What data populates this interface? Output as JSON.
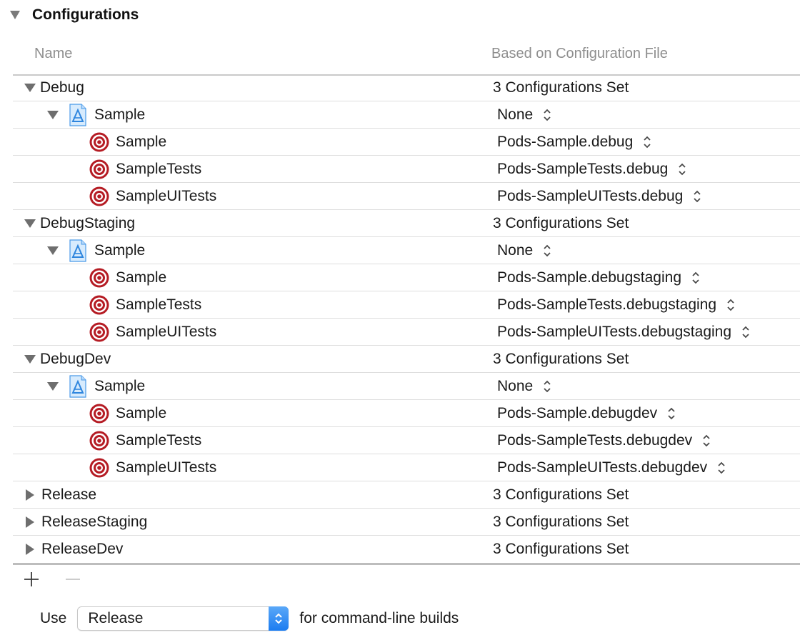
{
  "section": {
    "title": "Configurations"
  },
  "columns": {
    "name": "Name",
    "based_on": "Based on Configuration File"
  },
  "configurations": [
    {
      "name": "Debug",
      "expanded": true,
      "summary": "3 Configurations Set",
      "project": {
        "name": "Sample",
        "value": "None"
      },
      "targets": [
        {
          "name": "Sample",
          "value": "Pods-Sample.debug"
        },
        {
          "name": "SampleTests",
          "value": "Pods-SampleTests.debug"
        },
        {
          "name": "SampleUITests",
          "value": "Pods-SampleUITests.debug"
        }
      ]
    },
    {
      "name": "DebugStaging",
      "expanded": true,
      "summary": "3 Configurations Set",
      "project": {
        "name": "Sample",
        "value": "None"
      },
      "targets": [
        {
          "name": "Sample",
          "value": "Pods-Sample.debugstaging"
        },
        {
          "name": "SampleTests",
          "value": "Pods-SampleTests.debugstaging"
        },
        {
          "name": "SampleUITests",
          "value": "Pods-SampleUITests.debugstaging"
        }
      ]
    },
    {
      "name": "DebugDev",
      "expanded": true,
      "summary": "3 Configurations Set",
      "project": {
        "name": "Sample",
        "value": "None"
      },
      "targets": [
        {
          "name": "Sample",
          "value": "Pods-Sample.debugdev"
        },
        {
          "name": "SampleTests",
          "value": "Pods-SampleTests.debugdev"
        },
        {
          "name": "SampleUITests",
          "value": "Pods-SampleUITests.debugdev"
        }
      ]
    },
    {
      "name": "Release",
      "expanded": false,
      "summary": "3 Configurations Set"
    },
    {
      "name": "ReleaseStaging",
      "expanded": false,
      "summary": "3 Configurations Set"
    },
    {
      "name": "ReleaseDev",
      "expanded": false,
      "summary": "3 Configurations Set"
    }
  ],
  "footer": {
    "use_label": "Use",
    "selected": "Release",
    "suffix": "for command-line builds"
  },
  "icons": {
    "project": "xcode-project-icon",
    "target": "target-icon",
    "add": "plus-icon",
    "remove": "minus-icon"
  },
  "colors": {
    "accent": "#1c7cf0",
    "target_red": "#b51c24"
  }
}
